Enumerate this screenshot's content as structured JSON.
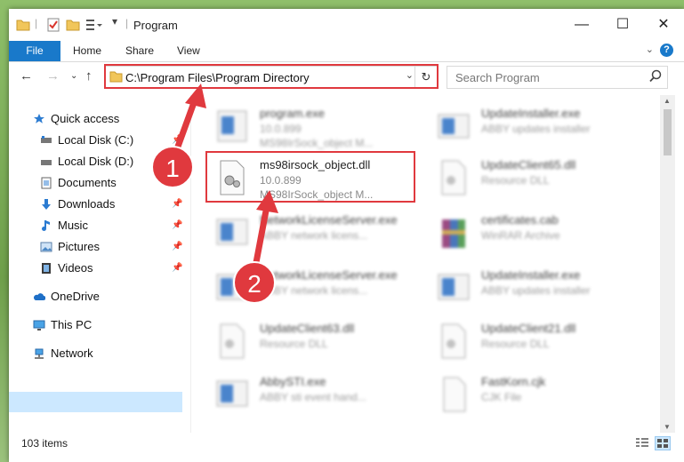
{
  "window": {
    "title": "Program"
  },
  "ribbon": {
    "file": "File",
    "tabs": [
      "Home",
      "Share",
      "View"
    ],
    "help": "?"
  },
  "address": {
    "path": "C:\\Program Files\\Program Directory"
  },
  "search": {
    "placeholder": "Search Program"
  },
  "sidebar": {
    "items": [
      {
        "label": "Quick access",
        "icon": "star-icon"
      },
      {
        "label": "Local Disk (C:)",
        "icon": "drive-icon"
      },
      {
        "label": "Local Disk (D:)",
        "icon": "drive-icon"
      },
      {
        "label": "Documents",
        "icon": "documents-icon"
      },
      {
        "label": "Downloads",
        "icon": "download-arrow-icon"
      },
      {
        "label": "Music",
        "icon": "music-note-icon"
      },
      {
        "label": "Pictures",
        "icon": "pictures-icon"
      },
      {
        "label": "Videos",
        "icon": "film-icon"
      },
      {
        "label": "OneDrive",
        "icon": "cloud-icon"
      },
      {
        "label": "This PC",
        "icon": "monitor-icon"
      },
      {
        "label": "Network",
        "icon": "network-icon"
      }
    ]
  },
  "files": [
    {
      "name": "program.exe",
      "line2": "10.0.899",
      "line3": "MS98IrSock_object M...",
      "icon": "exe-icon"
    },
    {
      "name": "UpdateInstaller.exe",
      "line2": "ABBY updates installer",
      "line3": "",
      "icon": "exe-icon"
    },
    {
      "name": "ms98irsock_object.dll",
      "line2": "10.0.899",
      "line3": "MS98IrSock_object M...",
      "icon": "dll-gear-icon"
    },
    {
      "name": "UpdateClient65.dll",
      "line2": "Resource DLL",
      "line3": "",
      "icon": "dll-gear-icon"
    },
    {
      "name": "NetworkLicenseServer.exe",
      "line2": "ABBY network licens...",
      "line3": "",
      "icon": "exe-icon"
    },
    {
      "name": "certificates.cab",
      "line2": "WinRAR Archive",
      "line3": "",
      "icon": "winrar-icon"
    },
    {
      "name": "NetworkLicenseServer.exe",
      "line2": "ABBY network licens...",
      "line3": "",
      "icon": "exe-icon"
    },
    {
      "name": "UpdateInstaller.exe",
      "line2": "ABBY updates installer",
      "line3": "",
      "icon": "exe-icon"
    },
    {
      "name": "UpdateClient63.dll",
      "line2": "Resource DLL",
      "line3": "",
      "icon": "dll-gear-icon"
    },
    {
      "name": "UpdateClient21.dll",
      "line2": "Resource DLL",
      "line3": "",
      "icon": "dll-gear-icon"
    },
    {
      "name": "AbbySTI.exe",
      "line2": "ABBY sti event hand...",
      "line3": "",
      "icon": "exe-icon"
    },
    {
      "name": "FastKorn.cjk",
      "line2": "CJK File",
      "line3": "",
      "icon": "blank-file-icon"
    }
  ],
  "status": {
    "items": "103 items"
  },
  "annotations": {
    "badge1": "1",
    "badge2": "2",
    "color": "#e0393e"
  }
}
